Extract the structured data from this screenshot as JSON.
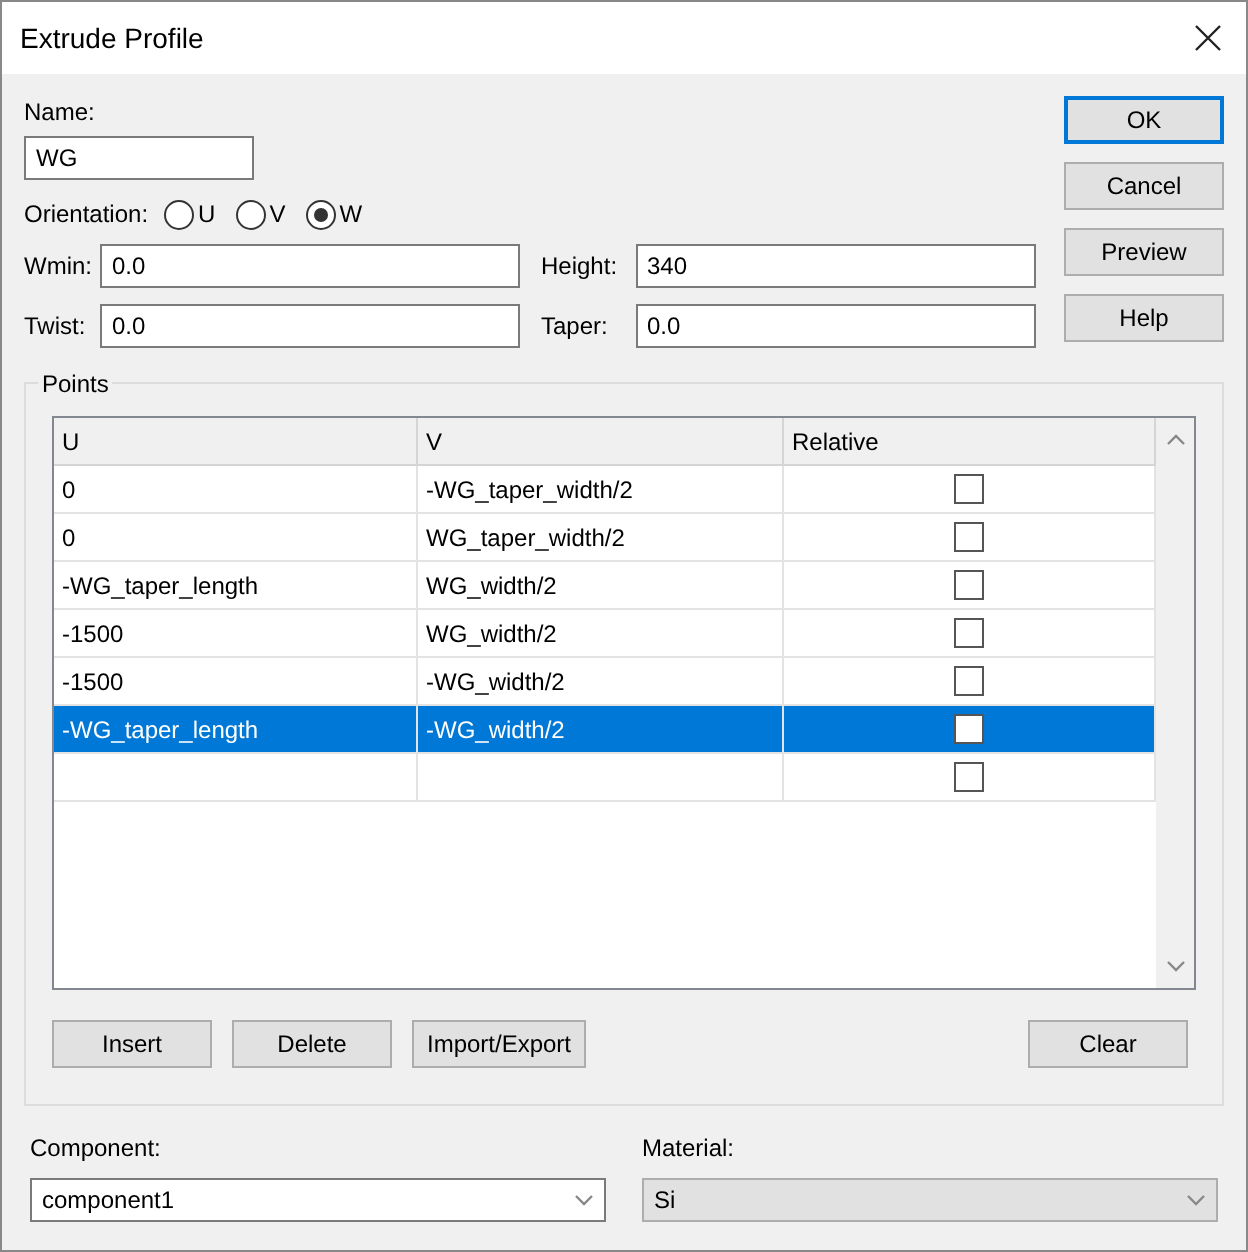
{
  "window": {
    "title": "Extrude Profile"
  },
  "name": {
    "label": "Name:",
    "value": "WG"
  },
  "orientation": {
    "label": "Orientation:",
    "options": [
      {
        "label": "U",
        "selected": false
      },
      {
        "label": "V",
        "selected": false
      },
      {
        "label": "W",
        "selected": true
      }
    ]
  },
  "fields": [
    {
      "label": "Wmin:",
      "value": "0.0"
    },
    {
      "label": "Height:",
      "value": "340"
    },
    {
      "label": "Twist:",
      "value": "0.0"
    },
    {
      "label": "Taper:",
      "value": "0.0"
    }
  ],
  "side_buttons": [
    {
      "label": "OK",
      "default": true
    },
    {
      "label": "Cancel",
      "default": false
    },
    {
      "label": "Preview",
      "default": false
    },
    {
      "label": "Help",
      "default": false
    }
  ],
  "points": {
    "title": "Points",
    "columns": [
      "U",
      "V",
      "Relative"
    ],
    "rows": [
      {
        "u": "0",
        "v": "-WG_taper_width/2",
        "checked": false,
        "selected": false
      },
      {
        "u": "0",
        "v": "WG_taper_width/2",
        "checked": false,
        "selected": false
      },
      {
        "u": "-WG_taper_length",
        "v": "WG_width/2",
        "checked": false,
        "selected": false
      },
      {
        "u": "-1500",
        "v": "WG_width/2",
        "checked": false,
        "selected": false
      },
      {
        "u": "-1500",
        "v": "-WG_width/2",
        "checked": false,
        "selected": false
      },
      {
        "u": "-WG_taper_length",
        "v": "-WG_width/2",
        "checked": false,
        "selected": true
      },
      {
        "u": "",
        "v": "",
        "checked": false,
        "selected": false
      }
    ],
    "buttons": [
      "Insert",
      "Delete",
      "Import/Export"
    ],
    "clear_button": "Clear"
  },
  "component": {
    "label": "Component:",
    "value": "component1"
  },
  "material": {
    "label": "Material:",
    "value": "Si",
    "disabled": true
  }
}
